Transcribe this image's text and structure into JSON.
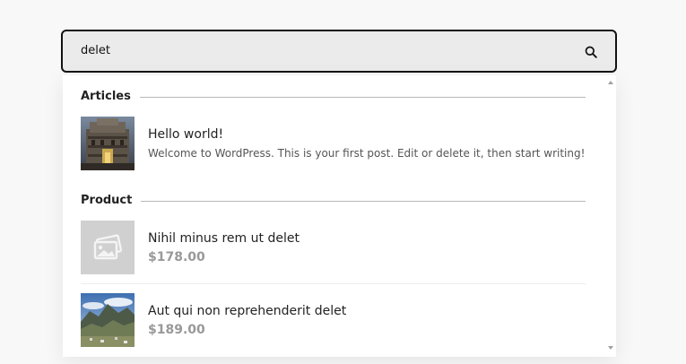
{
  "search": {
    "value": "delet",
    "icon": "search-icon"
  },
  "sections": [
    {
      "title": "Articles",
      "items": [
        {
          "title": "Hello world!",
          "excerpt": "Welcome to WordPress. This is your first post. Edit or delete it, then start writing!",
          "thumbnail": "temple-photo"
        }
      ]
    },
    {
      "title": "Product",
      "items": [
        {
          "title": "Nihil minus rem ut delet",
          "price": "$178.00",
          "thumbnail": "placeholder-image-icon"
        },
        {
          "title": "Aut qui non reprehenderit delet",
          "price": "$189.00",
          "thumbnail": "mountain-photo"
        }
      ]
    }
  ],
  "colors": {
    "page_bg": "#f8f8f8",
    "search_bg": "#ebebeb",
    "search_border": "#111111",
    "price": "#999999",
    "rule": "#b9b9b9"
  }
}
